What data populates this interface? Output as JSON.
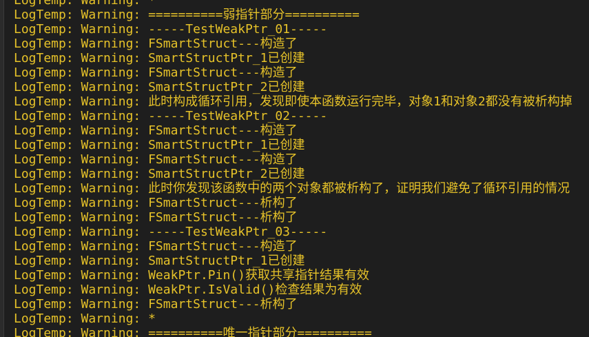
{
  "console": {
    "lines": [
      {
        "category": "LogTemp",
        "level": "Warning",
        "message": "*"
      },
      {
        "category": "LogTemp",
        "level": "Warning",
        "message": "==========弱指针部分=========="
      },
      {
        "category": "LogTemp",
        "level": "Warning",
        "message": "-----TestWeakPtr_01-----"
      },
      {
        "category": "LogTemp",
        "level": "Warning",
        "message": "FSmartStruct---构造了"
      },
      {
        "category": "LogTemp",
        "level": "Warning",
        "message": "SmartStructPtr_1已创建"
      },
      {
        "category": "LogTemp",
        "level": "Warning",
        "message": "FSmartStruct---构造了"
      },
      {
        "category": "LogTemp",
        "level": "Warning",
        "message": "SmartStructPtr_2已创建"
      },
      {
        "category": "LogTemp",
        "level": "Warning",
        "message": "此时构成循环引用，发现即使本函数运行完毕，对象1和对象2都没有被析构掉"
      },
      {
        "category": "LogTemp",
        "level": "Warning",
        "message": "-----TestWeakPtr_02-----"
      },
      {
        "category": "LogTemp",
        "level": "Warning",
        "message": "FSmartStruct---构造了"
      },
      {
        "category": "LogTemp",
        "level": "Warning",
        "message": "SmartStructPtr_1已创建"
      },
      {
        "category": "LogTemp",
        "level": "Warning",
        "message": "FSmartStruct---构造了"
      },
      {
        "category": "LogTemp",
        "level": "Warning",
        "message": "SmartStructPtr_2已创建"
      },
      {
        "category": "LogTemp",
        "level": "Warning",
        "message": "此时你发现该函数中的两个对象都被析构了，证明我们避免了循环引用的情况"
      },
      {
        "category": "LogTemp",
        "level": "Warning",
        "message": "FSmartStruct---析构了"
      },
      {
        "category": "LogTemp",
        "level": "Warning",
        "message": "FSmartStruct---析构了"
      },
      {
        "category": "LogTemp",
        "level": "Warning",
        "message": "-----TestWeakPtr_03-----"
      },
      {
        "category": "LogTemp",
        "level": "Warning",
        "message": "FSmartStruct---构造了"
      },
      {
        "category": "LogTemp",
        "level": "Warning",
        "message": "SmartStructPtr_1已创建"
      },
      {
        "category": "LogTemp",
        "level": "Warning",
        "message": "WeakPtr.Pin()获取共享指针结果有效"
      },
      {
        "category": "LogTemp",
        "level": "Warning",
        "message": "WeakPtr.IsValid()检查结果为有效"
      },
      {
        "category": "LogTemp",
        "level": "Warning",
        "message": "FSmartStruct---析构了"
      },
      {
        "category": "LogTemp",
        "level": "Warning",
        "message": "*"
      },
      {
        "category": "LogTemp",
        "level": "Warning",
        "message": "==========唯一指针部分=========="
      }
    ],
    "colors": {
      "background": "#1e1e1e",
      "warning_text": "#e6c229"
    }
  }
}
